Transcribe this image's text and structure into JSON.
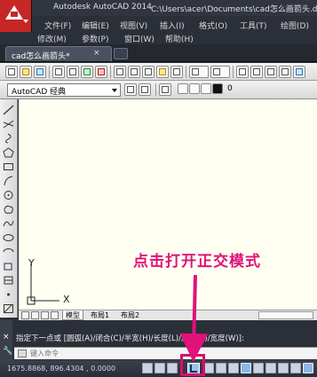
{
  "title_bar": {
    "app_name": "Autodesk AutoCAD 2014",
    "file_path": "C:\\Users\\acer\\Documents\\cad怎么画箭头.dwg"
  },
  "menu": {
    "row1": [
      "文件(F)",
      "编辑(E)",
      "视图(V)",
      "插入(I)",
      "格式(O)",
      "工具(T)",
      "绘图(D)"
    ],
    "row2": [
      "修改(M)",
      "参数(P)",
      "窗口(W)",
      "帮助(H)"
    ]
  },
  "document_tab": {
    "label": "cad怎么画箭头*",
    "close": "×"
  },
  "toolbar2": {
    "workspace": "AutoCAD 经典",
    "layer_value": "0"
  },
  "canvas": {
    "ucs_y_label": "Y",
    "ucs_x_label": "X",
    "background": "#fffff2"
  },
  "layout_tabs": [
    "模型",
    "布局1",
    "布局2"
  ],
  "command": {
    "history": "指定下一点或 [圆弧(A)/闭合(C)/半宽(H)/长度(L)/放弃(U)/宽度(W)]:",
    "placeholder": "键入命令",
    "close_glyph": "×"
  },
  "status": {
    "coordinates": "1675.8868, 896.4304 , 0.0000",
    "ortho_mode_active": true
  },
  "annotation": {
    "callout": "点击打开正交模式",
    "color": "#e0127a"
  },
  "icons": {
    "app": "autocad-a-logo",
    "ortho": "ortho-mode-icon"
  }
}
